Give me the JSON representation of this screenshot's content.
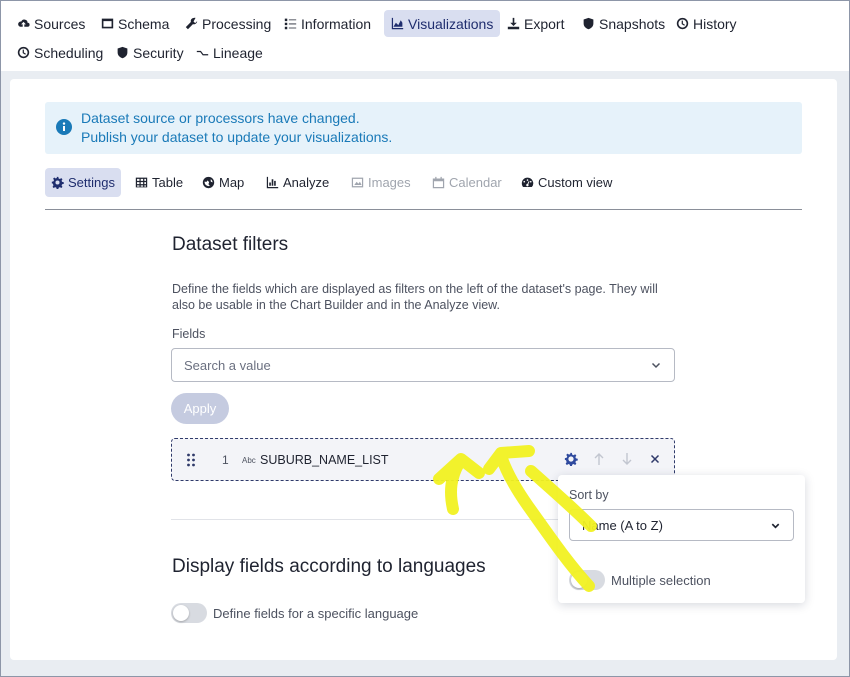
{
  "topnav": {
    "items": [
      {
        "label": "Sources",
        "icon": "cloud-upload-icon",
        "active": false
      },
      {
        "label": "Schema",
        "icon": "window-icon",
        "active": false
      },
      {
        "label": "Processing",
        "icon": "wrench-icon",
        "active": false
      },
      {
        "label": "Information",
        "icon": "list-icon",
        "active": false
      },
      {
        "label": "Visualizations",
        "icon": "area-chart-icon",
        "active": true
      },
      {
        "label": "Export",
        "icon": "download-icon",
        "active": false
      },
      {
        "label": "Snapshots",
        "icon": "shield-icon",
        "active": false
      },
      {
        "label": "History",
        "icon": "clock-icon",
        "active": false
      },
      {
        "label": "Scheduling",
        "icon": "clock-icon",
        "active": false
      },
      {
        "label": "Security",
        "icon": "shield-icon",
        "active": false
      },
      {
        "label": "Lineage",
        "icon": "lineage-icon",
        "active": false
      }
    ]
  },
  "alert": {
    "line1": "Dataset source or processors have changed.",
    "line2": "Publish your dataset to update your visualizations.",
    "color": "#1a7ab8"
  },
  "subtabs": [
    {
      "label": "Settings",
      "icon": "gear-icon",
      "state": "active"
    },
    {
      "label": "Table",
      "icon": "table-icon",
      "state": "normal"
    },
    {
      "label": "Map",
      "icon": "globe-icon",
      "state": "normal"
    },
    {
      "label": "Analyze",
      "icon": "bar-chart-icon",
      "state": "normal"
    },
    {
      "label": "Images",
      "icon": "image-icon",
      "state": "disabled"
    },
    {
      "label": "Calendar",
      "icon": "calendar-icon",
      "state": "disabled"
    },
    {
      "label": "Custom view",
      "icon": "dashboard-icon",
      "state": "normal"
    }
  ],
  "filters": {
    "title": "Dataset filters",
    "description_line1": "Define the fields which are displayed as filters on the left of the dataset's page. They will",
    "description_line2": "also be usable in the Chart Builder and in the Analyze view.",
    "fields_label": "Fields",
    "search_placeholder": "Search a value",
    "apply_label": "Apply",
    "field": {
      "index": "1",
      "type_badge": "Abc",
      "name": "SUBURB_NAME_LIST"
    }
  },
  "languages": {
    "title": "Display fields according to languages",
    "toggle_label": "Define fields for a specific language"
  },
  "popover": {
    "sort_label": "Sort by",
    "sort_value": "Name (A to Z)",
    "multiple_label": "Multiple selection"
  },
  "annotation_color": "#f2f222"
}
